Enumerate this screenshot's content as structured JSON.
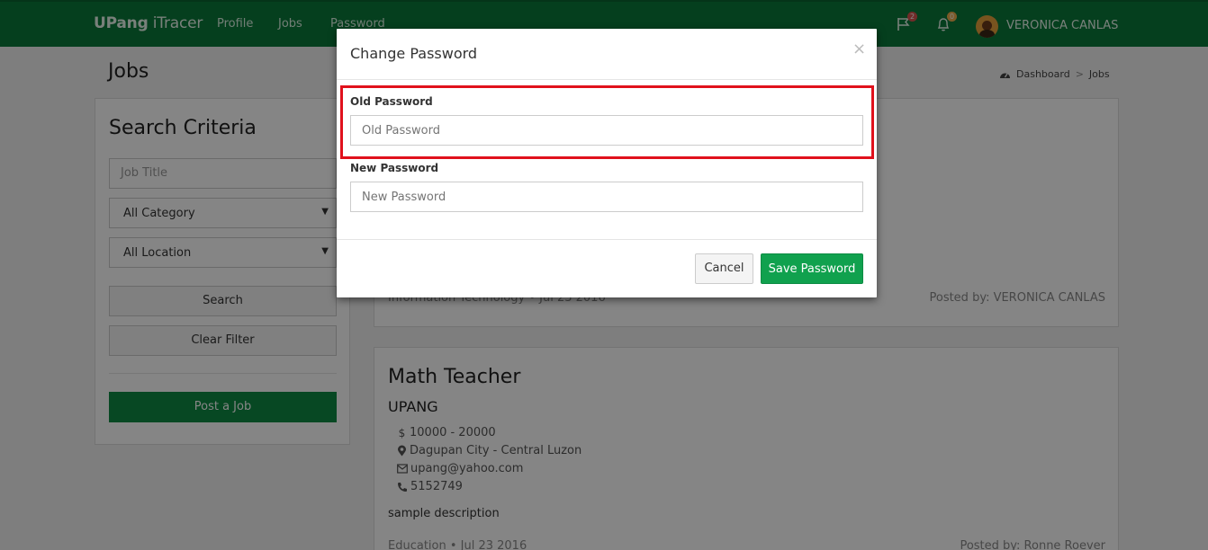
{
  "nav": {
    "brand_bold": "UPang",
    "brand_rest": " iTracer",
    "links": [
      "Profile",
      "Jobs",
      "Password"
    ],
    "flag_count": "2",
    "bell_count": "0",
    "user_name": "VERONICA CANLAS"
  },
  "page": {
    "title": "Jobs",
    "breadcrumb": [
      "Dashboard",
      "Jobs"
    ]
  },
  "sidebar": {
    "heading": "Search Criteria",
    "job_title_placeholder": "Job Title",
    "category": "All Category",
    "location": "All Location",
    "search_label": "Search",
    "clear_label": "Clear Filter",
    "post_label": "Post a Job"
  },
  "jobs": [
    {
      "meta_left": "Information Technology  •  Jul 23 2016",
      "posted_by": "Posted by: VERONICA CANLAS"
    },
    {
      "title": "Math Teacher",
      "company": "UPANG",
      "salary": "10000 - 20000",
      "location": "Dagupan City - Central Luzon",
      "email": "upang@yahoo.com",
      "phone": "5152749",
      "description": "sample description",
      "meta_left": "Education  •  Jul 23 2016",
      "posted_by": "Posted by: Ronne Roever"
    }
  ],
  "modal": {
    "title": "Change Password",
    "close": "×",
    "old_label": "Old Password",
    "old_placeholder": "Old Password",
    "new_label": "New Password",
    "new_placeholder": "New Password",
    "cancel_label": "Cancel",
    "save_label": "Save Password"
  },
  "colors": {
    "navbar": "#0b7a3a",
    "primary_green": "#10a14e",
    "highlight": "#e0111c"
  }
}
